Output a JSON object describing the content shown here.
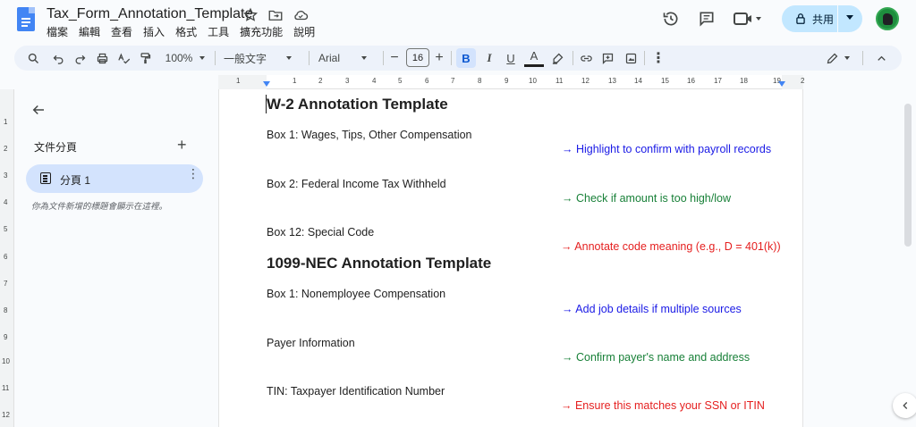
{
  "doc": {
    "title": "Tax_Form_Annotation_Template"
  },
  "menu": [
    "檔案",
    "編輯",
    "查看",
    "插入",
    "格式",
    "工具",
    "擴充功能",
    "說明"
  ],
  "share": {
    "label": "共用"
  },
  "toolbar": {
    "zoom": "100%",
    "style": "一般文字",
    "font": "Arial",
    "font_size": "16",
    "bold": "B",
    "italic": "I",
    "underline": "U",
    "text_color": "A"
  },
  "ruler": {
    "numbers": [
      "1",
      "1",
      "2",
      "3",
      "4",
      "5",
      "6",
      "7",
      "8",
      "9",
      "10",
      "11",
      "12",
      "13",
      "14",
      "15",
      "16",
      "17",
      "18",
      "19",
      "2"
    ],
    "vnumbers": [
      "1",
      "2",
      "3",
      "4",
      "5",
      "6",
      "7",
      "8",
      "9",
      "10",
      "11",
      "12"
    ]
  },
  "sidebar": {
    "outline_title": "文件分頁",
    "add": "+",
    "tab_label": "分頁 1",
    "tab_more": "⋮",
    "hint": "你為文件新增的標題會顯示在這裡。"
  },
  "content": {
    "h1": "W-2 Annotation Template",
    "w2_box1": "Box 1: Wages, Tips, Other Compensation",
    "w2_note1": "→ Highlight to confirm with payroll records",
    "w2_box2": "Box 2: Federal Income Tax Withheld",
    "w2_note2": "→ Check if amount is too high/low",
    "w2_box12": "Box 12: Special Code",
    "w2_note3": "→ Annotate code meaning (e.g., D = 401(k))",
    "h2": "1099-NEC Annotation Template",
    "nec_box1": "Box 1: Nonemployee Compensation",
    "nec_note1": "→ Add job details if multiple sources",
    "nec_payer": "Payer Information",
    "nec_note2": "→ Confirm payer's name and address",
    "nec_tin": "TIN: Taxpayer Identification Number",
    "nec_note3": "→ Ensure this matches your SSN or ITIN"
  },
  "colors": {
    "blue": "#1a1ae6",
    "green": "#188038",
    "red": "#e52020"
  }
}
